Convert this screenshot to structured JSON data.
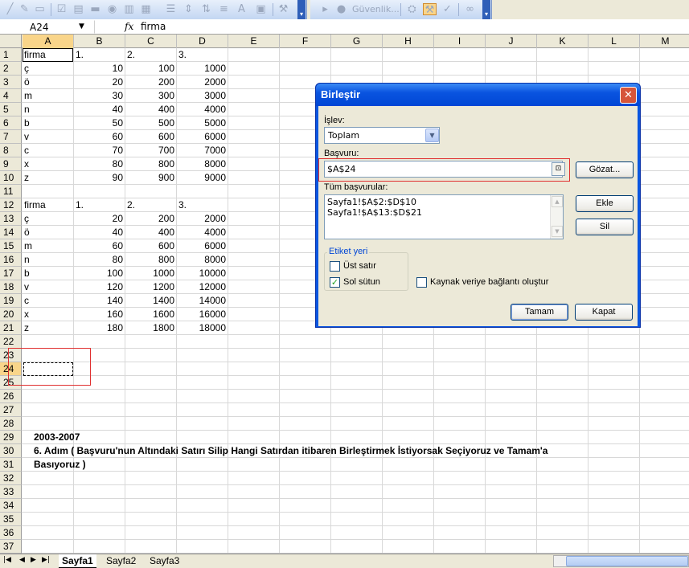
{
  "toolbar": {
    "security_label": "Güvenlik...",
    "icons_left": [
      "chart-icon",
      "edit-icon",
      "comment-icon",
      "checkbox-icon",
      "list-icon",
      "button-icon",
      "option-icon",
      "listbox-icon",
      "combo-icon",
      "scroll-icon",
      "spinner-icon",
      "label-icon",
      "image-icon",
      "properties-icon",
      "text-icon",
      "picture-icon"
    ],
    "icons_right": [
      "play-icon",
      "record-icon",
      "toolbox-icon",
      "design-icon",
      "wrench-icon",
      "visual-icon"
    ]
  },
  "formula_bar": {
    "name_box": "A24",
    "fx": "fx",
    "value": "firma"
  },
  "columns": [
    "A",
    "B",
    "C",
    "D",
    "E",
    "F",
    "G",
    "H",
    "I",
    "J",
    "K",
    "L",
    "M"
  ],
  "rows": [
    {
      "n": "1",
      "cells": [
        "firma",
        "1.",
        "2.",
        "3."
      ]
    },
    {
      "n": "2",
      "cells": [
        "ç",
        "10",
        "100",
        "1000"
      ]
    },
    {
      "n": "3",
      "cells": [
        "ö",
        "20",
        "200",
        "2000"
      ]
    },
    {
      "n": "4",
      "cells": [
        "m",
        "30",
        "300",
        "3000"
      ]
    },
    {
      "n": "5",
      "cells": [
        "n",
        "40",
        "400",
        "4000"
      ]
    },
    {
      "n": "6",
      "cells": [
        "b",
        "50",
        "500",
        "5000"
      ]
    },
    {
      "n": "7",
      "cells": [
        "v",
        "60",
        "600",
        "6000"
      ]
    },
    {
      "n": "8",
      "cells": [
        "c",
        "70",
        "700",
        "7000"
      ]
    },
    {
      "n": "9",
      "cells": [
        "x",
        "80",
        "800",
        "8000"
      ]
    },
    {
      "n": "10",
      "cells": [
        "z",
        "90",
        "900",
        "9000"
      ]
    },
    {
      "n": "11",
      "cells": [
        "",
        "",
        "",
        ""
      ]
    },
    {
      "n": "12",
      "cells": [
        "firma",
        "1.",
        "2.",
        "3."
      ]
    },
    {
      "n": "13",
      "cells": [
        "ç",
        "20",
        "200",
        "2000"
      ]
    },
    {
      "n": "14",
      "cells": [
        "ö",
        "40",
        "400",
        "4000"
      ]
    },
    {
      "n": "15",
      "cells": [
        "m",
        "60",
        "600",
        "6000"
      ]
    },
    {
      "n": "16",
      "cells": [
        "n",
        "80",
        "800",
        "8000"
      ]
    },
    {
      "n": "17",
      "cells": [
        "b",
        "100",
        "1000",
        "10000"
      ]
    },
    {
      "n": "18",
      "cells": [
        "v",
        "120",
        "1200",
        "12000"
      ]
    },
    {
      "n": "19",
      "cells": [
        "c",
        "140",
        "1400",
        "14000"
      ]
    },
    {
      "n": "20",
      "cells": [
        "x",
        "160",
        "1600",
        "16000"
      ]
    },
    {
      "n": "21",
      "cells": [
        "z",
        "180",
        "1800",
        "18000"
      ]
    },
    {
      "n": "22",
      "cells": [
        "",
        "",
        "",
        ""
      ]
    },
    {
      "n": "23",
      "cells": [
        "",
        "",
        "",
        ""
      ]
    },
    {
      "n": "24",
      "cells": [
        "",
        "",
        "",
        ""
      ]
    },
    {
      "n": "25",
      "cells": [
        "",
        "",
        "",
        ""
      ]
    },
    {
      "n": "26",
      "cells": [
        "",
        "",
        "",
        ""
      ]
    },
    {
      "n": "27",
      "cells": [
        "",
        "",
        "",
        ""
      ]
    },
    {
      "n": "28",
      "cells": [
        "",
        "",
        "",
        ""
      ]
    },
    {
      "n": "29",
      "cells": [
        "",
        "",
        "",
        ""
      ]
    },
    {
      "n": "30",
      "cells": [
        "",
        "",
        "",
        ""
      ]
    },
    {
      "n": "31",
      "cells": [
        "",
        "",
        "",
        ""
      ]
    },
    {
      "n": "32",
      "cells": [
        "",
        "",
        "",
        ""
      ]
    },
    {
      "n": "33",
      "cells": [
        "",
        "",
        "",
        ""
      ]
    },
    {
      "n": "34",
      "cells": [
        "",
        "",
        "",
        ""
      ]
    },
    {
      "n": "35",
      "cells": [
        "",
        "",
        "",
        ""
      ]
    },
    {
      "n": "36",
      "cells": [
        "",
        "",
        "",
        ""
      ]
    },
    {
      "n": "37",
      "cells": [
        "",
        "",
        "",
        ""
      ]
    }
  ],
  "notes": {
    "year": "2003-2007",
    "step_line1": "6. Adım ( Başvuru'nun Altındaki Satırı Silip Hangi Satırdan itibaren Birleştirmek İstiyorsak Seçiyoruz ve Tamam'a",
    "step_line2": "Basıyoruz )"
  },
  "dialog": {
    "title": "Birleştir",
    "function_label": "İşlev:",
    "function_value": "Toplam",
    "reference_label": "Başvuru:",
    "reference_value": "$A$24",
    "browse_button": "Gözat...",
    "all_refs_label": "Tüm başvurular:",
    "all_refs": [
      "Sayfa1!$A$2:$D$10",
      "Sayfa1!$A$13:$D$21"
    ],
    "add_button": "Ekle",
    "delete_button": "Sil",
    "labels_group": "Etiket yeri",
    "top_row": "Üst satır",
    "top_row_checked": false,
    "left_column": "Sol sütun",
    "left_column_checked": true,
    "link_source": "Kaynak veriye bağlantı oluştur",
    "link_source_checked": false,
    "ok_button": "Tamam",
    "close_button": "Kapat"
  },
  "sheet_tabs": [
    "Sayfa1",
    "Sayfa2",
    "Sayfa3"
  ],
  "active_tab": "Sayfa1"
}
